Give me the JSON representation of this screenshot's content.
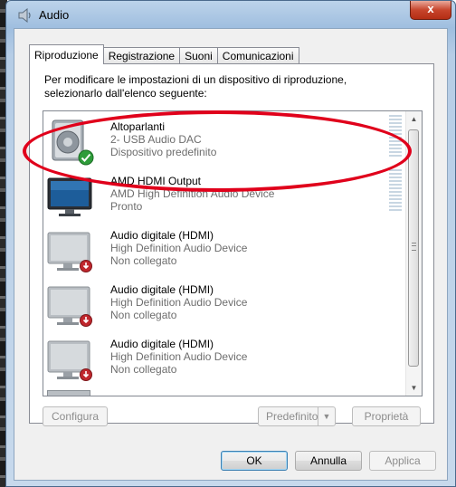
{
  "window": {
    "title": "Audio",
    "close_label": "x"
  },
  "tabs": [
    {
      "label": "Riproduzione",
      "active": true
    },
    {
      "label": "Registrazione",
      "active": false
    },
    {
      "label": "Suoni",
      "active": false
    },
    {
      "label": "Comunicazioni",
      "active": false
    }
  ],
  "instructions": "Per modificare le impostazioni di un dispositivo di riproduzione, selezionarlo dall'elenco seguente:",
  "devices": [
    {
      "name": "Altoparlanti",
      "line2": "2- USB Audio DAC",
      "status": "Dispositivo predefinito",
      "icon": "speaker-icon",
      "badge": "default-check-icon"
    },
    {
      "name": "AMD HDMI Output",
      "line2": "AMD High Definition Audio Device",
      "status": "Pronto",
      "icon": "monitor-icon",
      "badge": ""
    },
    {
      "name": "Audio digitale (HDMI)",
      "line2": "High Definition Audio Device",
      "status": "Non collegato",
      "icon": "monitor-disconnected-icon",
      "badge": "unplugged-icon"
    },
    {
      "name": "Audio digitale (HDMI)",
      "line2": "High Definition Audio Device",
      "status": "Non collegato",
      "icon": "monitor-disconnected-icon",
      "badge": "unplugged-icon"
    },
    {
      "name": "Audio digitale (HDMI)",
      "line2": "High Definition Audio Device",
      "status": "Non collegato",
      "icon": "monitor-disconnected-icon",
      "badge": "unplugged-icon"
    }
  ],
  "panel_buttons": {
    "configure": "Configura",
    "set_default": "Predefinito",
    "properties": "Proprietà"
  },
  "dialog_buttons": {
    "ok": "OK",
    "cancel": "Annulla",
    "apply": "Applica"
  },
  "colors": {
    "annotation": "#e0001b",
    "accent": "#3c7fb1"
  }
}
